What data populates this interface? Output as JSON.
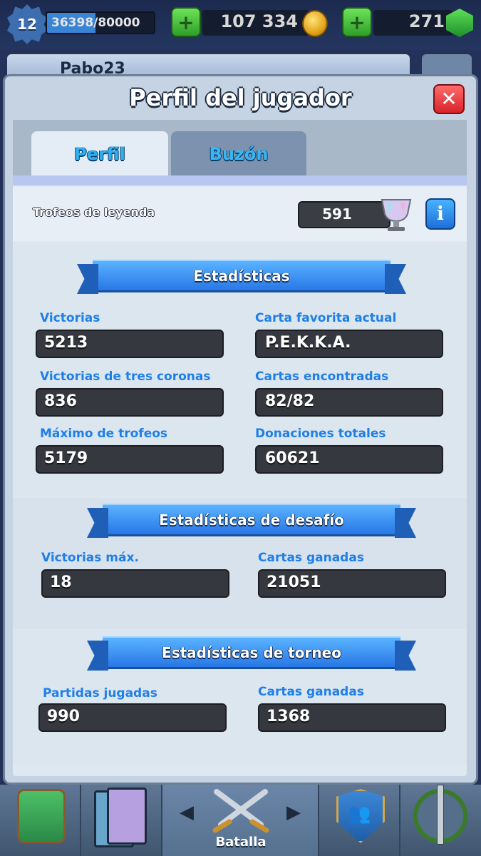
{
  "topbar": {
    "level": "12",
    "xp_text": "36398/80000",
    "xp_fraction": 0.455,
    "gold": "107 334",
    "gems": "271",
    "gold_add_icon": "plus-icon",
    "gems_add_icon": "plus-icon"
  },
  "background": {
    "player_name_partial": "Pabo23"
  },
  "modal": {
    "title": "Perfil del jugador",
    "close_icon": "close-icon",
    "tabs": [
      {
        "label": "Perfil",
        "active": true
      },
      {
        "label": "Buzón",
        "active": false
      }
    ],
    "legend": {
      "label": "Trofeos de leyenda",
      "value": "591",
      "info_label": "i"
    },
    "sections": [
      {
        "title": "Estadísticas",
        "stats": [
          {
            "label": "Victorias",
            "value": "5213"
          },
          {
            "label": "Carta favorita actual",
            "value": "P.E.K.K.A."
          },
          {
            "label": "Victorias de tres coronas",
            "value": "836"
          },
          {
            "label": "Cartas encontradas",
            "value": "82/82"
          },
          {
            "label": "Máximo de trofeos",
            "value": "5179"
          },
          {
            "label": "Donaciones totales",
            "value": "60621"
          }
        ]
      },
      {
        "title": "Estadísticas de desafío",
        "stats": [
          {
            "label": "Victorias máx.",
            "value": "18"
          },
          {
            "label": "Cartas ganadas",
            "value": "21051"
          }
        ]
      },
      {
        "title": "Estadísticas de torneo",
        "stats": [
          {
            "label": "Partidas jugadas",
            "value": "990"
          },
          {
            "label": "Cartas ganadas",
            "value": "1368"
          }
        ]
      }
    ]
  },
  "bottom_nav": {
    "items": [
      {
        "icon": "chest-icon"
      },
      {
        "icon": "cards-icon"
      },
      {
        "icon": "swords-icon",
        "label": "Batalla",
        "active": true
      },
      {
        "icon": "clan-icon"
      },
      {
        "icon": "tournament-icon"
      }
    ]
  },
  "colors": {
    "stat_label": "#1f7fe8",
    "ribbon": "#2877e6",
    "close_button": "#d9232a",
    "plus_button": "#2f9e2a"
  }
}
